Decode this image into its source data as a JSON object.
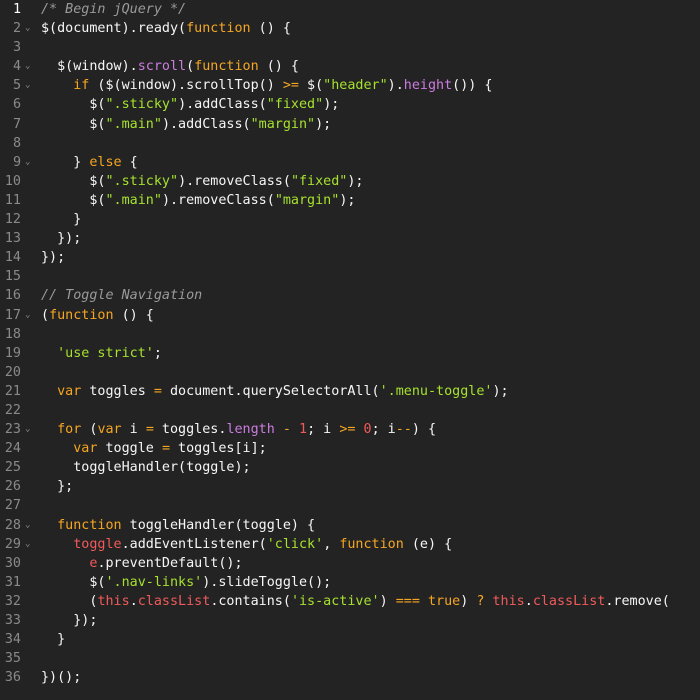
{
  "editor": {
    "language": "javascript",
    "colors": {
      "background": "#232323",
      "line_number": "#8a8a8a",
      "active_line_number": "#ffffff",
      "comment": "#9a9a9a",
      "keyword": "#f5a623",
      "string": "#a6e22e",
      "number": "#f05a5a",
      "method": "#cc7be0",
      "this": "#f05a5a",
      "text": "#f6f6f6"
    },
    "lines": [
      {
        "n": "1",
        "fold": "",
        "active": true,
        "tokens": [
          {
            "t": "comment",
            "v": "/* Begin jQuery */"
          }
        ]
      },
      {
        "n": "2",
        "fold": "⌄",
        "tokens": [
          {
            "t": "plain",
            "v": "$(document).ready("
          },
          {
            "t": "keyword",
            "v": "function"
          },
          {
            "t": "plain",
            "v": " () {"
          }
        ]
      },
      {
        "n": "3",
        "fold": "",
        "tokens": []
      },
      {
        "n": "4",
        "fold": "⌄",
        "tokens": [
          {
            "t": "plain",
            "v": "  $(window)."
          },
          {
            "t": "method",
            "v": "scroll"
          },
          {
            "t": "plain",
            "v": "("
          },
          {
            "t": "keyword",
            "v": "function"
          },
          {
            "t": "plain",
            "v": " () {"
          }
        ]
      },
      {
        "n": "5",
        "fold": "⌄",
        "tokens": [
          {
            "t": "plain",
            "v": "    "
          },
          {
            "t": "keyword",
            "v": "if"
          },
          {
            "t": "plain",
            "v": " ($(window).scrollTop() "
          },
          {
            "t": "keyword",
            "v": ">="
          },
          {
            "t": "plain",
            "v": " $("
          },
          {
            "t": "string",
            "v": "\"header\""
          },
          {
            "t": "plain",
            "v": ")."
          },
          {
            "t": "method",
            "v": "height"
          },
          {
            "t": "plain",
            "v": "()) {"
          }
        ]
      },
      {
        "n": "6",
        "fold": "",
        "tokens": [
          {
            "t": "plain",
            "v": "      $("
          },
          {
            "t": "string",
            "v": "\".sticky\""
          },
          {
            "t": "plain",
            "v": ").addClass("
          },
          {
            "t": "string",
            "v": "\"fixed\""
          },
          {
            "t": "plain",
            "v": ");"
          }
        ]
      },
      {
        "n": "7",
        "fold": "",
        "tokens": [
          {
            "t": "plain",
            "v": "      $("
          },
          {
            "t": "string",
            "v": "\".main\""
          },
          {
            "t": "plain",
            "v": ").addClass("
          },
          {
            "t": "string",
            "v": "\"margin\""
          },
          {
            "t": "plain",
            "v": ");"
          }
        ]
      },
      {
        "n": "8",
        "fold": "",
        "tokens": []
      },
      {
        "n": "9",
        "fold": "⌄",
        "tokens": [
          {
            "t": "plain",
            "v": "    } "
          },
          {
            "t": "keyword",
            "v": "else"
          },
          {
            "t": "plain",
            "v": " {"
          }
        ]
      },
      {
        "n": "10",
        "fold": "",
        "tokens": [
          {
            "t": "plain",
            "v": "      $("
          },
          {
            "t": "string",
            "v": "\".sticky\""
          },
          {
            "t": "plain",
            "v": ").removeClass("
          },
          {
            "t": "string",
            "v": "\"fixed\""
          },
          {
            "t": "plain",
            "v": ");"
          }
        ]
      },
      {
        "n": "11",
        "fold": "",
        "tokens": [
          {
            "t": "plain",
            "v": "      $("
          },
          {
            "t": "string",
            "v": "\".main\""
          },
          {
            "t": "plain",
            "v": ").removeClass("
          },
          {
            "t": "string",
            "v": "\"margin\""
          },
          {
            "t": "plain",
            "v": ");"
          }
        ]
      },
      {
        "n": "12",
        "fold": "",
        "tokens": [
          {
            "t": "plain",
            "v": "    }"
          }
        ]
      },
      {
        "n": "13",
        "fold": "",
        "tokens": [
          {
            "t": "plain",
            "v": "  });"
          }
        ]
      },
      {
        "n": "14",
        "fold": "",
        "tokens": [
          {
            "t": "plain",
            "v": "});"
          }
        ]
      },
      {
        "n": "15",
        "fold": "",
        "tokens": []
      },
      {
        "n": "16",
        "fold": "",
        "tokens": [
          {
            "t": "comment",
            "v": "// Toggle Navigation"
          }
        ]
      },
      {
        "n": "17",
        "fold": "⌄",
        "tokens": [
          {
            "t": "plain",
            "v": "("
          },
          {
            "t": "keyword",
            "v": "function"
          },
          {
            "t": "plain",
            "v": " () {"
          }
        ]
      },
      {
        "n": "18",
        "fold": "",
        "tokens": []
      },
      {
        "n": "19",
        "fold": "",
        "tokens": [
          {
            "t": "plain",
            "v": "  "
          },
          {
            "t": "string",
            "v": "'use strict'"
          },
          {
            "t": "plain",
            "v": ";"
          }
        ]
      },
      {
        "n": "20",
        "fold": "",
        "tokens": []
      },
      {
        "n": "21",
        "fold": "",
        "tokens": [
          {
            "t": "plain",
            "v": "  "
          },
          {
            "t": "keyword",
            "v": "var"
          },
          {
            "t": "plain",
            "v": " toggles "
          },
          {
            "t": "keyword",
            "v": "="
          },
          {
            "t": "plain",
            "v": " document.querySelectorAll("
          },
          {
            "t": "string",
            "v": "'.menu-toggle'"
          },
          {
            "t": "plain",
            "v": ");"
          }
        ]
      },
      {
        "n": "22",
        "fold": "",
        "tokens": []
      },
      {
        "n": "23",
        "fold": "⌄",
        "tokens": [
          {
            "t": "plain",
            "v": "  "
          },
          {
            "t": "keyword",
            "v": "for"
          },
          {
            "t": "plain",
            "v": " ("
          },
          {
            "t": "keyword",
            "v": "var"
          },
          {
            "t": "plain",
            "v": " i "
          },
          {
            "t": "keyword",
            "v": "="
          },
          {
            "t": "plain",
            "v": " toggles."
          },
          {
            "t": "method",
            "v": "length"
          },
          {
            "t": "plain",
            "v": " "
          },
          {
            "t": "keyword",
            "v": "-"
          },
          {
            "t": "plain",
            "v": " "
          },
          {
            "t": "number",
            "v": "1"
          },
          {
            "t": "plain",
            "v": "; i "
          },
          {
            "t": "keyword",
            "v": ">="
          },
          {
            "t": "plain",
            "v": " "
          },
          {
            "t": "number",
            "v": "0"
          },
          {
            "t": "plain",
            "v": "; i"
          },
          {
            "t": "keyword",
            "v": "--"
          },
          {
            "t": "plain",
            "v": ") {"
          }
        ]
      },
      {
        "n": "24",
        "fold": "",
        "tokens": [
          {
            "t": "plain",
            "v": "    "
          },
          {
            "t": "keyword",
            "v": "var"
          },
          {
            "t": "plain",
            "v": " toggle "
          },
          {
            "t": "keyword",
            "v": "="
          },
          {
            "t": "plain",
            "v": " toggles[i];"
          }
        ]
      },
      {
        "n": "25",
        "fold": "",
        "tokens": [
          {
            "t": "plain",
            "v": "    toggleHandler(toggle);"
          }
        ]
      },
      {
        "n": "26",
        "fold": "",
        "tokens": [
          {
            "t": "plain",
            "v": "  };"
          }
        ]
      },
      {
        "n": "27",
        "fold": "",
        "tokens": []
      },
      {
        "n": "28",
        "fold": "⌄",
        "tokens": [
          {
            "t": "plain",
            "v": "  "
          },
          {
            "t": "keyword",
            "v": "function"
          },
          {
            "t": "plain",
            "v": " toggleHandler(toggle) {"
          }
        ]
      },
      {
        "n": "29",
        "fold": "⌄",
        "tokens": [
          {
            "t": "plain",
            "v": "    "
          },
          {
            "t": "this",
            "v": "toggle"
          },
          {
            "t": "plain",
            "v": ".addEventListener("
          },
          {
            "t": "string",
            "v": "'click'"
          },
          {
            "t": "plain",
            "v": ", "
          },
          {
            "t": "keyword",
            "v": "function"
          },
          {
            "t": "plain",
            "v": " (e) {"
          }
        ]
      },
      {
        "n": "30",
        "fold": "",
        "tokens": [
          {
            "t": "plain",
            "v": "      "
          },
          {
            "t": "this",
            "v": "e"
          },
          {
            "t": "plain",
            "v": ".preventDefault();"
          }
        ]
      },
      {
        "n": "31",
        "fold": "",
        "tokens": [
          {
            "t": "plain",
            "v": "      $("
          },
          {
            "t": "string",
            "v": "'.nav-links'"
          },
          {
            "t": "plain",
            "v": ").slideToggle();"
          }
        ]
      },
      {
        "n": "32",
        "fold": "",
        "tokens": [
          {
            "t": "plain",
            "v": "      ("
          },
          {
            "t": "this",
            "v": "this"
          },
          {
            "t": "plain",
            "v": "."
          },
          {
            "t": "this",
            "v": "classList"
          },
          {
            "t": "plain",
            "v": ".contains("
          },
          {
            "t": "string",
            "v": "'is-active'"
          },
          {
            "t": "plain",
            "v": ") "
          },
          {
            "t": "keyword",
            "v": "==="
          },
          {
            "t": "plain",
            "v": " "
          },
          {
            "t": "keyword",
            "v": "true"
          },
          {
            "t": "plain",
            "v": ") "
          },
          {
            "t": "keyword",
            "v": "?"
          },
          {
            "t": "plain",
            "v": " "
          },
          {
            "t": "this",
            "v": "this"
          },
          {
            "t": "plain",
            "v": "."
          },
          {
            "t": "this",
            "v": "classList"
          },
          {
            "t": "plain",
            "v": ".remove("
          }
        ]
      },
      {
        "n": "33",
        "fold": "",
        "tokens": [
          {
            "t": "plain",
            "v": "    });"
          }
        ]
      },
      {
        "n": "34",
        "fold": "",
        "tokens": [
          {
            "t": "plain",
            "v": "  }"
          }
        ]
      },
      {
        "n": "35",
        "fold": "",
        "tokens": []
      },
      {
        "n": "36",
        "fold": "",
        "tokens": [
          {
            "t": "plain",
            "v": "})();"
          }
        ]
      }
    ]
  }
}
